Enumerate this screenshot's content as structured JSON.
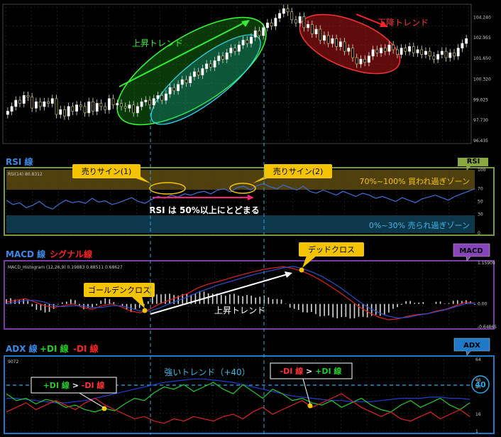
{
  "colors": {
    "background": "#000000",
    "grid": "#3a3a3a",
    "candle_up": "#ffffff",
    "candle_down": "#bbbb66",
    "uptrend": "#22dd22",
    "downtrend": "#dd2222",
    "rsi_line": "#3b6fd8",
    "macd_main": "#e02020",
    "macd_signal": "#2a4fd0",
    "plus_di": "#22cc22",
    "minus_di": "#dd2222",
    "adx": "#1e3fcf",
    "rsi_border": "#7a9a3a",
    "macd_border": "#7a3aa8",
    "adx_border": "#1e7ac8",
    "callout": "#f5c400"
  },
  "chart_data": [
    {
      "type": "candlestick",
      "panel": "price",
      "y_tick_labels": [
        "104.240",
        "102.955",
        "101.650",
        "100.320",
        "99.025",
        "97.730",
        "96.435"
      ],
      "ylim": [
        96.435,
        104.9
      ],
      "close": [
        98.3,
        98.6,
        99.0,
        98.8,
        99.3,
        99.2,
        98.5,
        98.9,
        98.6,
        98.9,
        98.8,
        99.1,
        98.1,
        98.4,
        98.0,
        98.6,
        98.3,
        98.7,
        98.6,
        98.2,
        98.9,
        98.3,
        98.8,
        98.6,
        98.4,
        99.1,
        98.7,
        98.8,
        98.6,
        98.5,
        98.7,
        98.2,
        98.6,
        98.9,
        99.0,
        98.7,
        99.1,
        99.3,
        99.0,
        99.4,
        99.8,
        99.6,
        100.0,
        100.3,
        100.1,
        100.5,
        100.8,
        100.6,
        101.0,
        101.3,
        101.1,
        101.5,
        101.8,
        101.6,
        102.0,
        102.3,
        102.1,
        102.5,
        102.8,
        102.6,
        103.0,
        103.4,
        103.1,
        103.6,
        103.9,
        103.7,
        104.2,
        104.5,
        104.8,
        104.6,
        104.1,
        103.9,
        104.3,
        103.6,
        103.8,
        103.2,
        103.5,
        102.8,
        103.1,
        102.6,
        102.9,
        102.4,
        102.7,
        102.1,
        102.3,
        101.7,
        101.3,
        101.6,
        101.4,
        101.8,
        102.2,
        102.0,
        102.3,
        102.1,
        102.5,
        102.2,
        101.9,
        102.3,
        102.1,
        102.4,
        102.0,
        102.2,
        101.9,
        102.1,
        101.8,
        101.6,
        101.9,
        102.1,
        101.7,
        102.0,
        101.8,
        102.3,
        102.6,
        102.9
      ]
    },
    {
      "type": "line",
      "panel": "rsi",
      "title": "RSI(14) 80.8312",
      "y_tick_labels": [
        "100",
        "70",
        "50",
        "30",
        "0"
      ],
      "ylim": [
        0,
        100
      ],
      "series": [
        {
          "values": [
            52,
            45,
            48,
            40,
            44,
            50,
            42,
            38,
            46,
            52,
            48,
            50,
            47,
            55,
            49,
            51,
            45,
            48,
            52,
            56,
            50,
            47,
            53,
            58,
            55,
            60,
            57,
            62,
            60,
            64,
            66,
            62,
            68,
            70,
            65,
            72,
            74,
            68,
            75,
            78,
            73,
            70,
            76,
            72,
            68,
            74,
            66,
            63,
            68,
            64,
            60,
            66,
            62,
            58,
            63,
            60,
            55,
            58,
            54,
            50,
            56,
            52,
            48,
            54,
            57,
            60,
            56,
            52,
            58,
            62,
            66,
            70
          ]
        }
      ]
    },
    {
      "type": "line",
      "panel": "macd",
      "title": "MACD_Histogram (12,26,9) 0.19883 0.88511 0.68627",
      "y_tick_labels": [
        "1.15909",
        "0.00",
        "-0.64865"
      ],
      "ylim": [
        -0.64865,
        1.15909
      ],
      "series": [
        {
          "values": [
            0.05,
            0.1,
            0.15,
            0.05,
            -0.05,
            -0.1,
            -0.05,
            0.0,
            -0.1,
            -0.15,
            -0.05,
            0.0,
            -0.08,
            -0.2,
            -0.25,
            -0.15,
            0.0,
            0.1,
            0.2,
            0.3,
            0.45,
            0.55,
            0.62,
            0.7,
            0.78,
            0.85,
            0.92,
            0.98,
            1.02,
            1.05,
            1.0,
            0.92,
            0.8,
            0.65,
            0.48,
            0.3,
            0.1,
            -0.1,
            -0.25,
            -0.38,
            -0.45,
            -0.42,
            -0.35,
            -0.3,
            -0.28,
            -0.2,
            -0.15,
            -0.05,
            0.05,
            0.02
          ]
        },
        {
          "values": [
            0.0,
            0.05,
            0.1,
            0.1,
            0.05,
            -0.05,
            -0.08,
            -0.05,
            -0.05,
            -0.1,
            -0.1,
            -0.05,
            -0.05,
            -0.12,
            -0.2,
            -0.2,
            -0.12,
            0.0,
            0.1,
            0.2,
            0.32,
            0.42,
            0.52,
            0.6,
            0.68,
            0.76,
            0.84,
            0.9,
            0.96,
            1.02,
            1.06,
            1.0,
            0.9,
            0.78,
            0.62,
            0.45,
            0.25,
            0.05,
            -0.12,
            -0.25,
            -0.35,
            -0.4,
            -0.38,
            -0.32,
            -0.28,
            -0.22,
            -0.16,
            -0.08,
            0.0,
            0.03
          ]
        }
      ]
    },
    {
      "type": "line",
      "panel": "adx",
      "y_tick_labels": [
        "64",
        "46",
        "40",
        "16",
        "1"
      ],
      "ylim": [
        1,
        64
      ],
      "series": [
        {
          "values": [
            34,
            28,
            30,
            25,
            29,
            27,
            22,
            24,
            20,
            18,
            21,
            19,
            25,
            30,
            28,
            35,
            40,
            38,
            42,
            36,
            40,
            44,
            38,
            34,
            42,
            36,
            30,
            38,
            34,
            28,
            30,
            26,
            24,
            28,
            22,
            26,
            30,
            24,
            20,
            18,
            24,
            28,
            22,
            26,
            30,
            24,
            20,
            26
          ]
        },
        {
          "values": [
            18,
            22,
            26,
            20,
            24,
            28,
            24,
            20,
            26,
            30,
            24,
            20,
            16,
            12,
            14,
            10,
            8,
            12,
            10,
            14,
            12,
            10,
            14,
            16,
            12,
            18,
            22,
            16,
            20,
            24,
            28,
            22,
            26,
            30,
            34,
            28,
            22,
            18,
            14,
            18,
            12,
            10,
            14,
            18,
            12,
            16,
            20,
            14
          ]
        },
        {
          "values": [
            30,
            30,
            29,
            28,
            27,
            26,
            26,
            27,
            28,
            30,
            32,
            34,
            36,
            38,
            40,
            42,
            44,
            45,
            46,
            47,
            47,
            46,
            45,
            44,
            42,
            40,
            38,
            36,
            34,
            32,
            31,
            30,
            29,
            28,
            28,
            27,
            27,
            27,
            28,
            29,
            30,
            30,
            30,
            31,
            31,
            30,
            30,
            29
          ]
        }
      ]
    }
  ],
  "price_panel": {
    "uptrend_label": "上昇トレンド",
    "downtrend_label": "下降トレンド"
  },
  "rsi_panel": {
    "section_label": "RSI 線",
    "badge": "RSI",
    "sell1": "売りサイン(1)",
    "sell2": "売りサイン(2)",
    "overbought": "70%~100%  買われ過ぎゾーン",
    "oversold": "0%~30%  売られ過ぎゾーン",
    "center_note": "RSI は 50%以上にとどまる"
  },
  "macd_panel": {
    "section_label": "MACD 線",
    "section_label_signal": "シグナル線",
    "badge": "MACD",
    "golden": "ゴールデンクロス",
    "dead": "デッドクロス",
    "uptrend": "上昇トレンド"
  },
  "adx_panel": {
    "section_label_adx": "ADX 線",
    "section_label_plus": "+DI 線",
    "section_label_minus": "-DI 線",
    "badge": "ADX",
    "corner_value": "9072",
    "strong": "強いトレンド（+40）",
    "callout_left_plus": "+DI 線",
    "callout_left_gt": " > ",
    "callout_left_minus": "-DI 線",
    "callout_right_minus": "-DI 線",
    "callout_right_gt": " > ",
    "callout_right_plus": "+DI 線",
    "circle_value": "40"
  }
}
